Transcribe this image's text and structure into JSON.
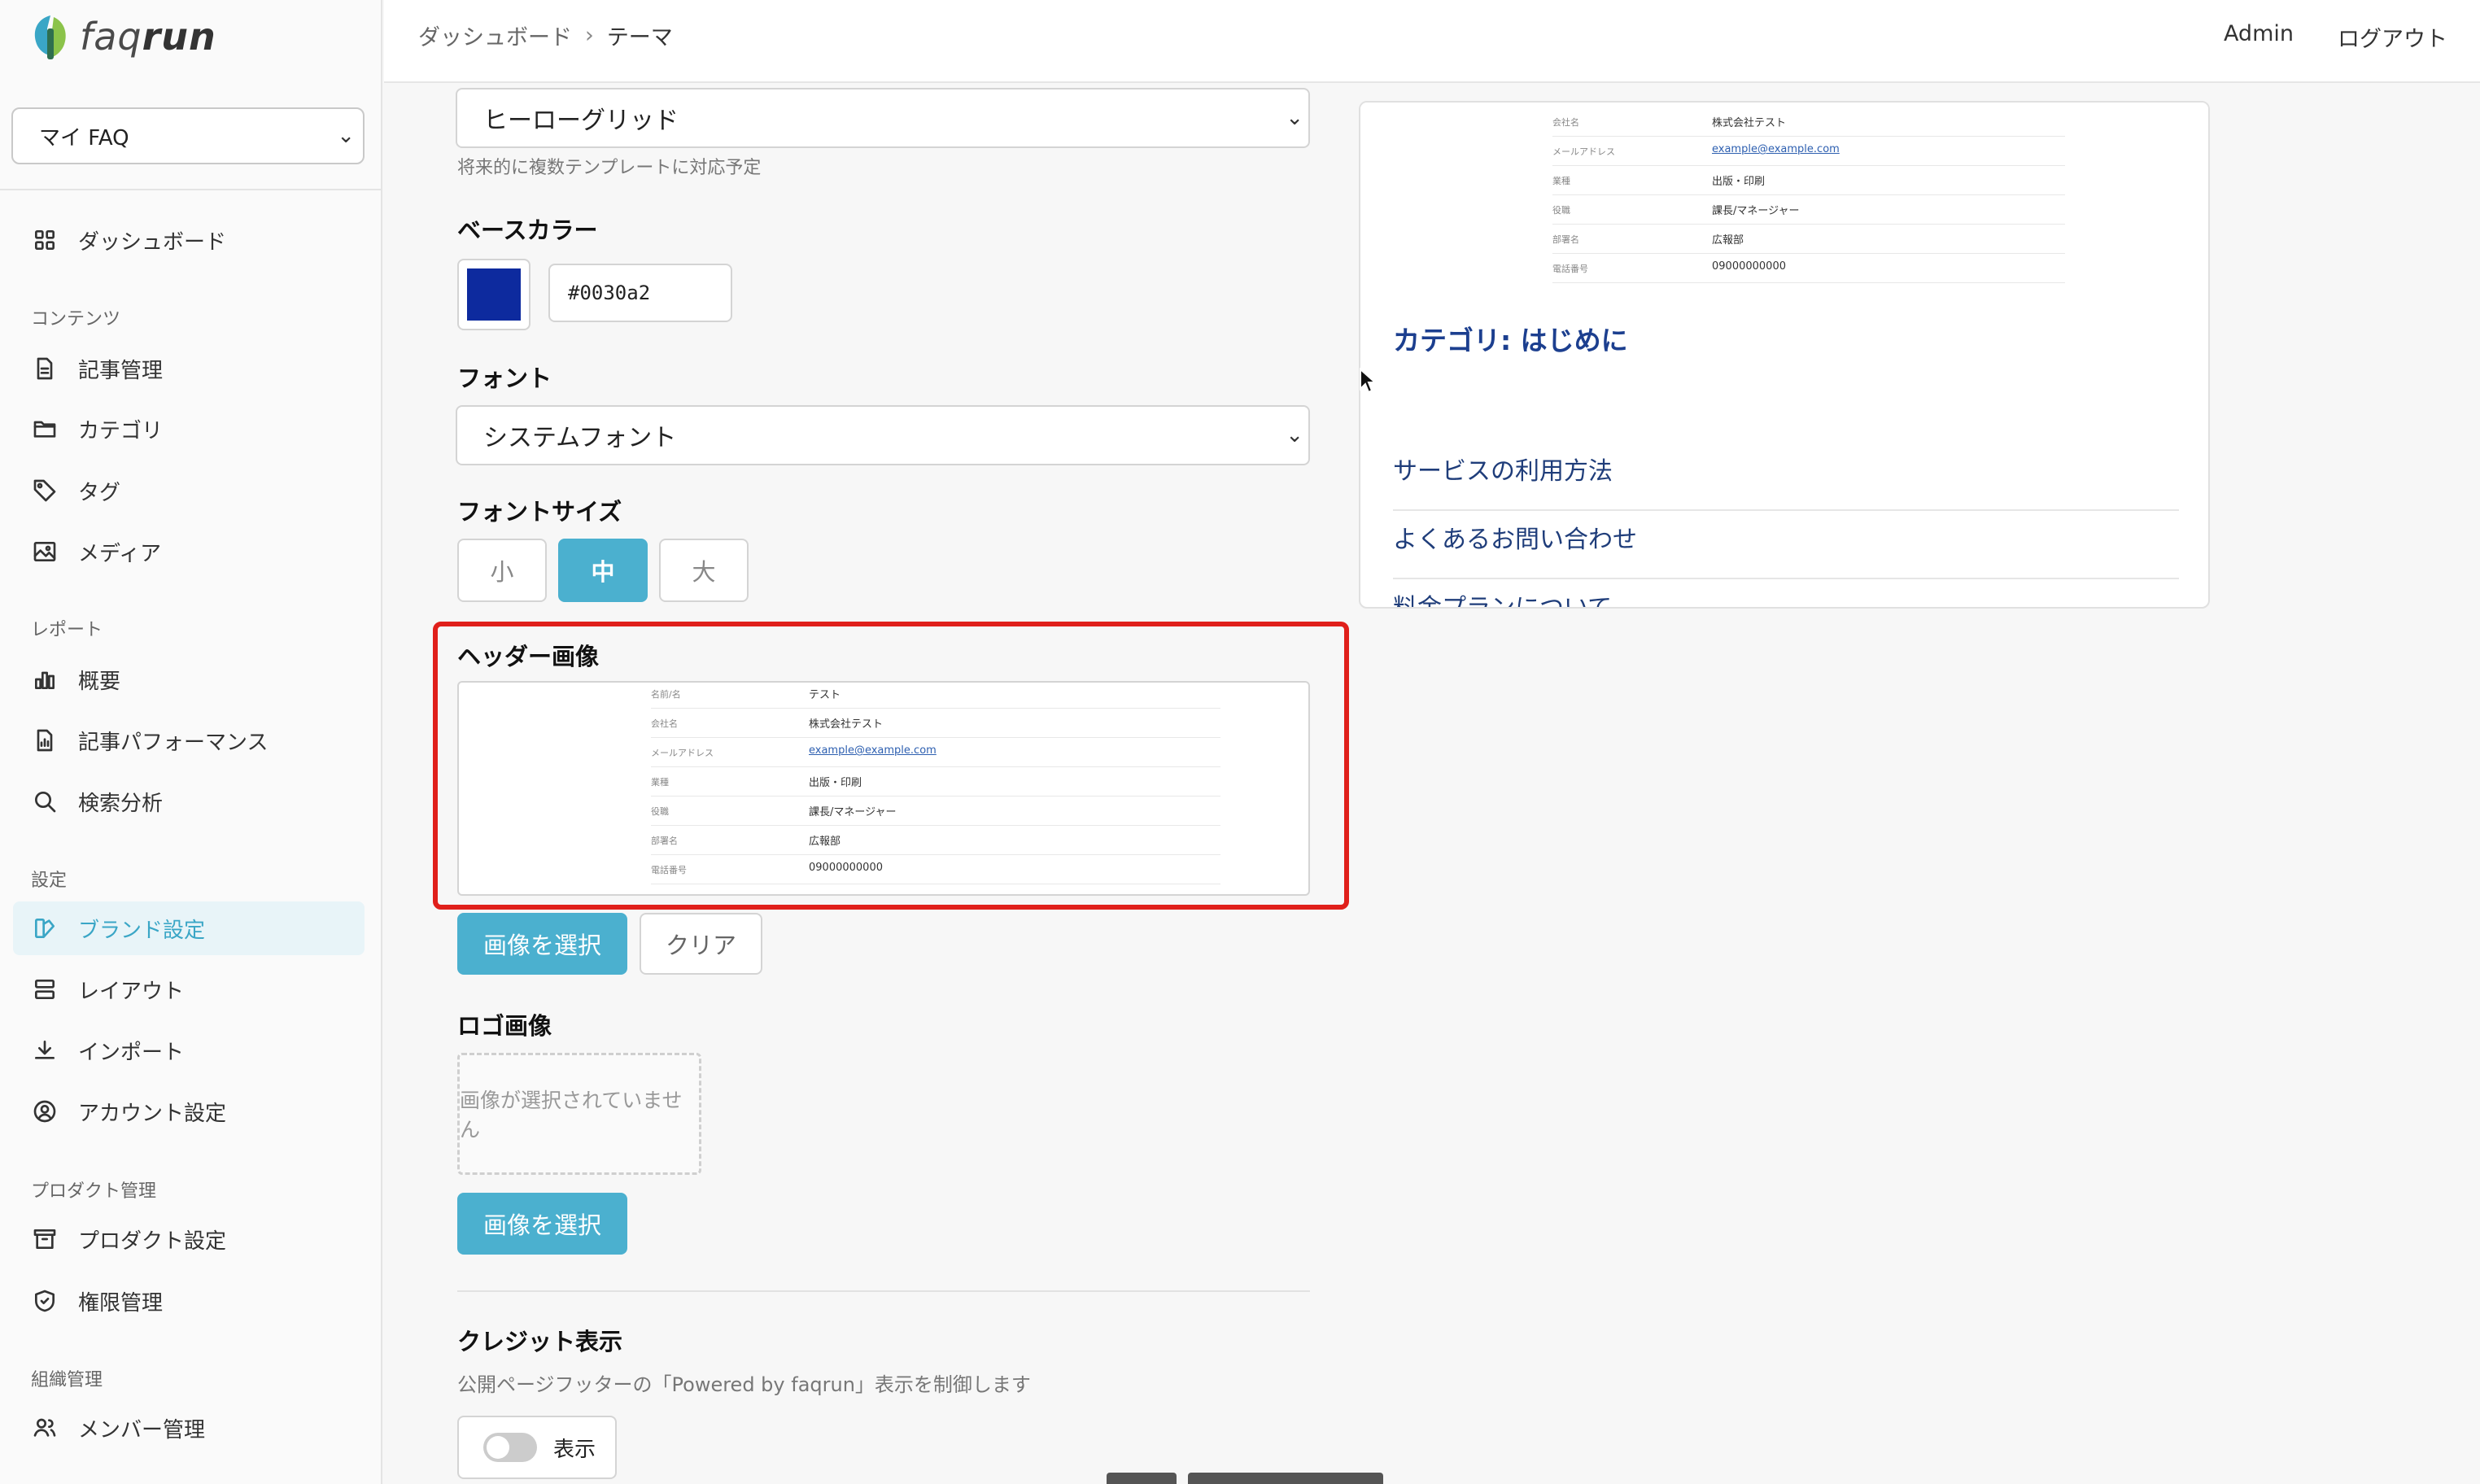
{
  "brand": {
    "logo_text_light": "faq",
    "logo_text_bold": "run"
  },
  "project_select": {
    "value": "マイ FAQ"
  },
  "sidebar": {
    "dashboard": "ダッシュボード",
    "sections": [
      {
        "label": "コンテンツ",
        "items": [
          "記事管理",
          "カテゴリ",
          "タグ",
          "メディア"
        ]
      },
      {
        "label": "レポート",
        "items": [
          "概要",
          "記事パフォーマンス",
          "検索分析"
        ]
      },
      {
        "label": "設定",
        "items": [
          "ブランド設定",
          "レイアウト",
          "インポート",
          "アカウント設定"
        ]
      },
      {
        "label": "プロダクト管理",
        "items": [
          "プロダクト設定",
          "権限管理"
        ]
      },
      {
        "label": "組織管理",
        "items": [
          "メンバー管理"
        ]
      }
    ],
    "active_item": "ブランド設定"
  },
  "header": {
    "breadcrumb": [
      "ダッシュボード",
      "テーマ"
    ],
    "user": "Admin",
    "logout": "ログアウト"
  },
  "form": {
    "template_select": "ヒーローグリッド",
    "template_help": "将来的に複数テンプレートに対応予定",
    "base_color_label": "ベースカラー",
    "base_color_value": "#0030a2",
    "font_label": "フォント",
    "font_select": "システムフォント",
    "font_size_label": "フォントサイズ",
    "font_sizes": [
      "小",
      "中",
      "大"
    ],
    "font_size_selected": "中",
    "header_image_label": "ヘッダー画像",
    "header_image_rows": [
      {
        "k": "名前/名",
        "v": "テスト"
      },
      {
        "k": "会社名",
        "v": "株式会社テスト"
      },
      {
        "k": "メールアドレス",
        "v": "example@example.com"
      },
      {
        "k": "業種",
        "v": "出版・印刷"
      },
      {
        "k": "役職",
        "v": "課長/マネージャー"
      },
      {
        "k": "部署名",
        "v": "広報部"
      },
      {
        "k": "電話番号",
        "v": "09000000000"
      }
    ],
    "select_image_button": "画像を選択",
    "clear_button": "クリア",
    "logo_image_label": "ロゴ画像",
    "logo_empty": "画像が選択されていません",
    "logo_select_button": "画像を選択",
    "credit_label": "クレジット表示",
    "credit_help": "公開ページフッターの「Powered by faqrun」表示を制御します",
    "credit_toggle_label": "表示",
    "credit_toggle_on": false
  },
  "preview": {
    "image_rows": [
      {
        "k": "会社名",
        "v": "株式会社テスト"
      },
      {
        "k": "メールアドレス",
        "v": "example@example.com"
      },
      {
        "k": "業種",
        "v": "出版・印刷"
      },
      {
        "k": "役職",
        "v": "課長/マネージャー"
      },
      {
        "k": "部署名",
        "v": "広報部"
      },
      {
        "k": "電話番号",
        "v": "09000000000"
      }
    ],
    "category_title": "カテゴリ: はじめに",
    "links": [
      "サービスの利用方法",
      "よくあるお問い合わせ",
      "料金プランについて"
    ]
  },
  "colors": {
    "accent": "#4bb0cf",
    "base": "#0030a2",
    "highlight": "#e0201b",
    "preview_title": "#1c3f8f"
  },
  "icons": [
    "grid-icon",
    "document-icon",
    "folder-icon",
    "tag-icon",
    "image-icon",
    "bar-chart-icon",
    "document-chart-icon",
    "search-icon",
    "palette-icon",
    "layout-icon",
    "download-icon",
    "user-circle-icon",
    "archive-icon",
    "shield-icon",
    "users-icon"
  ]
}
